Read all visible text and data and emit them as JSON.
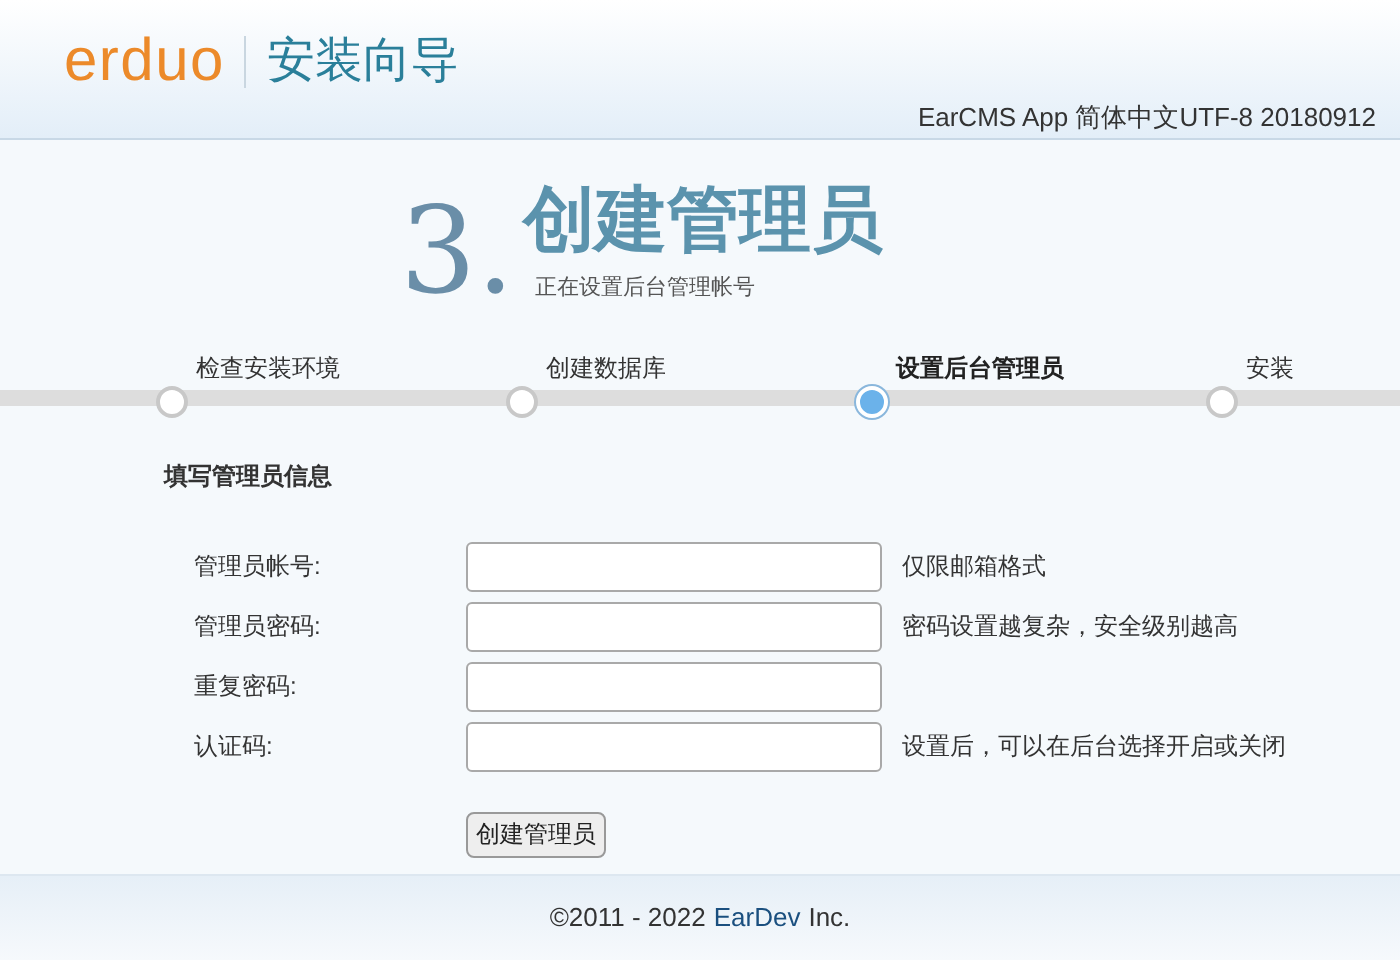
{
  "header": {
    "logo": "erduo",
    "title": "安装向导",
    "version": "EarCMS App 简体中文UTF-8 20180912"
  },
  "step_heading": {
    "number": "3.",
    "title": "创建管理员",
    "subtitle": "正在设置后台管理帐号"
  },
  "steps": [
    {
      "label": "检查安装环境",
      "selected": false
    },
    {
      "label": "创建数据库",
      "selected": false
    },
    {
      "label": "设置后台管理员",
      "selected": true
    },
    {
      "label": "安装",
      "selected": false
    }
  ],
  "form": {
    "title": "填写管理员信息",
    "fields": [
      {
        "label": "管理员帐号:",
        "hint": "仅限邮箱格式"
      },
      {
        "label": "管理员密码:",
        "hint": "密码设置越复杂，安全级别越高"
      },
      {
        "label": "重复密码:"
      },
      {
        "label": "认证码:",
        "hint": "设置后，可以在后台选择开启或关闭"
      }
    ],
    "submit": "创建管理员"
  },
  "footer": {
    "copyright": "©2011 - 2022",
    "link": "EarDev",
    "suffix": "Inc."
  }
}
